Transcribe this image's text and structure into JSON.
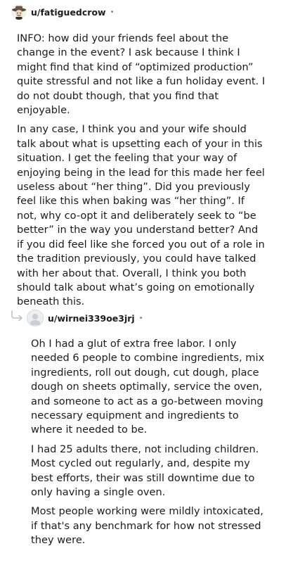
{
  "comments": [
    {
      "username": "u/fatiguedcrow",
      "separator": "•",
      "avatar_icon": "cowboy-cartoon-avatar-icon",
      "paragraphs": [
        "INFO: how did your friends feel about the change in the event? I ask because I think I might find that kind of “optimized production” quite stressful and not like a fun holiday event. I do not doubt though, that you find that enjoyable.",
        "In any case, I think you and your wife should talk about what is upsetting each of your in this situation. I get the feeling that your way of enjoying being in the lead for this made her feel useless about “her thing”. Did you previously feel like this when baking was “her thing”. If not, why co-opt it and deliberately seek to “be better” in the way you understand better? And if you did feel like she forced you out of a role in the tradition previously, you could have talked with her about that. Overall, I think you both should talk about what’s going on emotionally beneath this."
      ]
    },
    {
      "username": "u/wirnei339oe3jrj",
      "separator": "•",
      "avatar_icon": "default-user-avatar-icon",
      "reply_icon": "reply-arrow-icon",
      "paragraphs": [
        "Oh I had a glut of extra free labor. I only needed 6 people to combine ingredients, mix ingredients, roll out dough, cut dough, place dough on sheets optimally, service the oven, and someone to act as a go-between moving necessary equipment and ingredients to where it needed to be.",
        "I had 25 adults there, not including children. Most cycled out regularly, and, despite my best efforts, their was still downtime due to only having a single oven.",
        "Most people working were mildly intoxicated, if that's any benchmark for how not stressed they were."
      ]
    }
  ]
}
